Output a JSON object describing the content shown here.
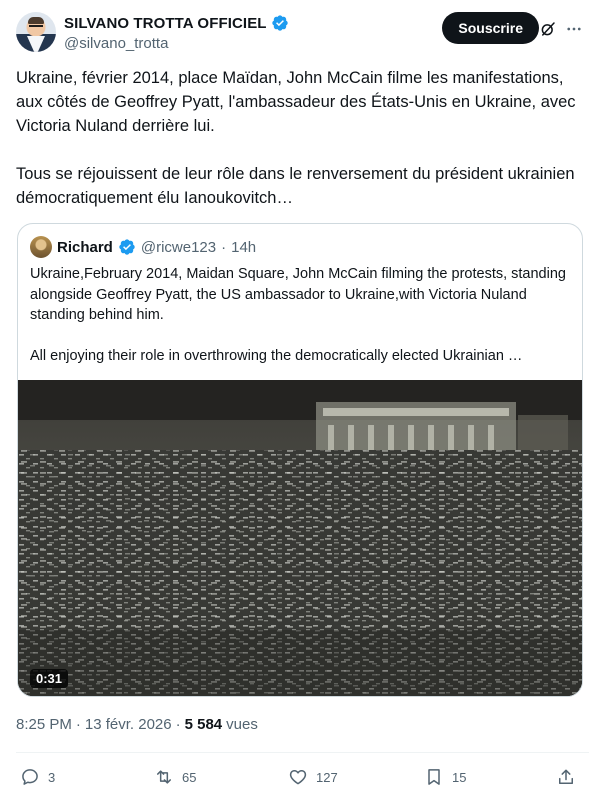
{
  "author": {
    "name": "SILVANO TROTTA OFFICIEL",
    "handle": "@silvano_trotta"
  },
  "header": {
    "subscribe_label": "Souscrire"
  },
  "tweet": {
    "paragraph1": "Ukraine, février 2014, place Maïdan, John McCain filme les manifestations, aux côtés de Geoffrey Pyatt, l'ambassadeur des États-Unis en Ukraine, avec Victoria Nuland derrière lui.",
    "paragraph2": "Tous se réjouissent de leur rôle dans le renversement du président ukrainien démocratiquement élu Ianoukovitch…"
  },
  "quote": {
    "name": "Richard",
    "handle": "@ricwe123",
    "separator": "·",
    "time": "14h",
    "paragraph1": "Ukraine,February 2014, Maidan Square, John McCain filming the protests, standing alongside Geoffrey Pyatt, the US ambassador to Ukraine,with Victoria Nuland standing behind him.",
    "paragraph2": "All enjoying their role in overthrowing the democratically elected Ukrainian …",
    "video_duration": "0:31"
  },
  "meta": {
    "time": "8:25 PM",
    "sep1": "·",
    "date": "13 févr. 2026",
    "sep2": "·",
    "views_count": "5 584",
    "views_label": "vues"
  },
  "actions": {
    "replies": "3",
    "reposts": "65",
    "likes": "127",
    "bookmarks": "15"
  },
  "colors": {
    "text": "#0f1419",
    "secondary": "#536471",
    "verified": "#1d9bf0",
    "border": "#cfd9de"
  },
  "icons": [
    "verified-badge-icon",
    "grok-icon",
    "more-icon",
    "reply-icon",
    "repost-icon",
    "like-icon",
    "bookmark-icon",
    "share-icon"
  ]
}
